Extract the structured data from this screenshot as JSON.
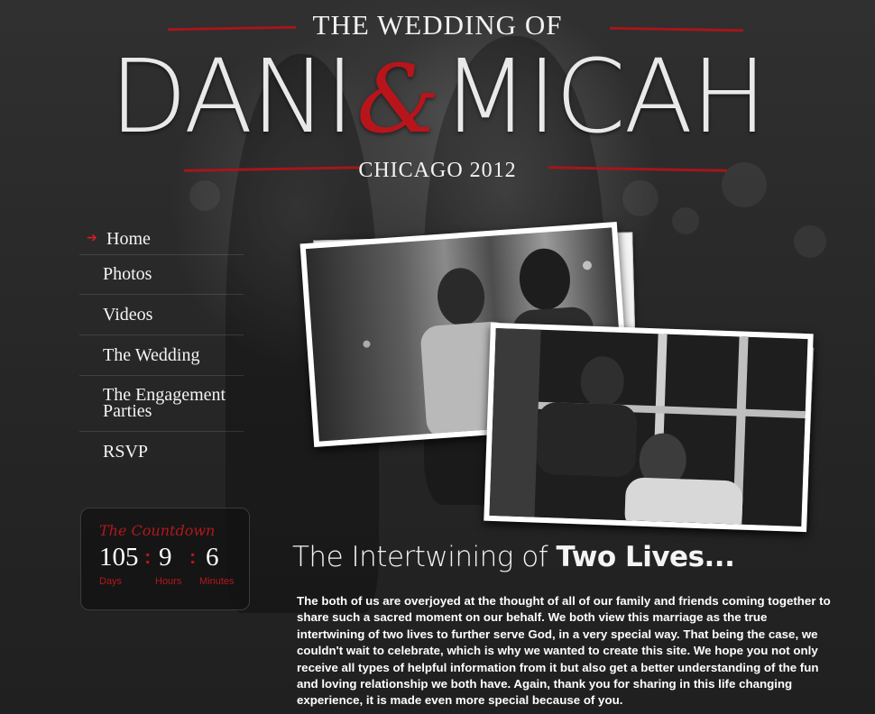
{
  "header": {
    "pre_title": "THE WEDDING OF",
    "name_left": "DANI",
    "ampersand": "&",
    "name_right": "MICAH",
    "subtitle": "CHICAGO 2012"
  },
  "nav": {
    "active_marker": "➔",
    "items": [
      {
        "label": "Home"
      },
      {
        "label": "Photos"
      },
      {
        "label": "Videos"
      },
      {
        "label": "The Wedding"
      },
      {
        "label": "The Engagement Parties"
      },
      {
        "label": "RSVP"
      }
    ]
  },
  "countdown": {
    "title": "The Countdown",
    "days": "105",
    "hours": "9",
    "minutes": "6",
    "separator": ":",
    "days_label": "Days",
    "hours_label": "Hours",
    "minutes_label": "Minutes"
  },
  "content": {
    "headline_light": "The Intertwining of",
    "headline_bold": "Two Lives...",
    "body": "The both of us are overjoyed at the thought of all of our family and friends coming together to share such a sacred moment on our behalf. We both view this marriage as the true intertwining of two lives to further serve God, in a very special way. That being the case, we couldn't wait to celebrate, which is why we wanted to create this site. We hope you not only receive all types of helpful information from it but also get a better understanding of the fun and loving relationship we both have. Again, thank you for sharing in this life changing experience, it is made even more special because of you."
  },
  "colors": {
    "accent_red": "#b7151b",
    "background": "#2a2a2a",
    "text": "#ffffff"
  }
}
